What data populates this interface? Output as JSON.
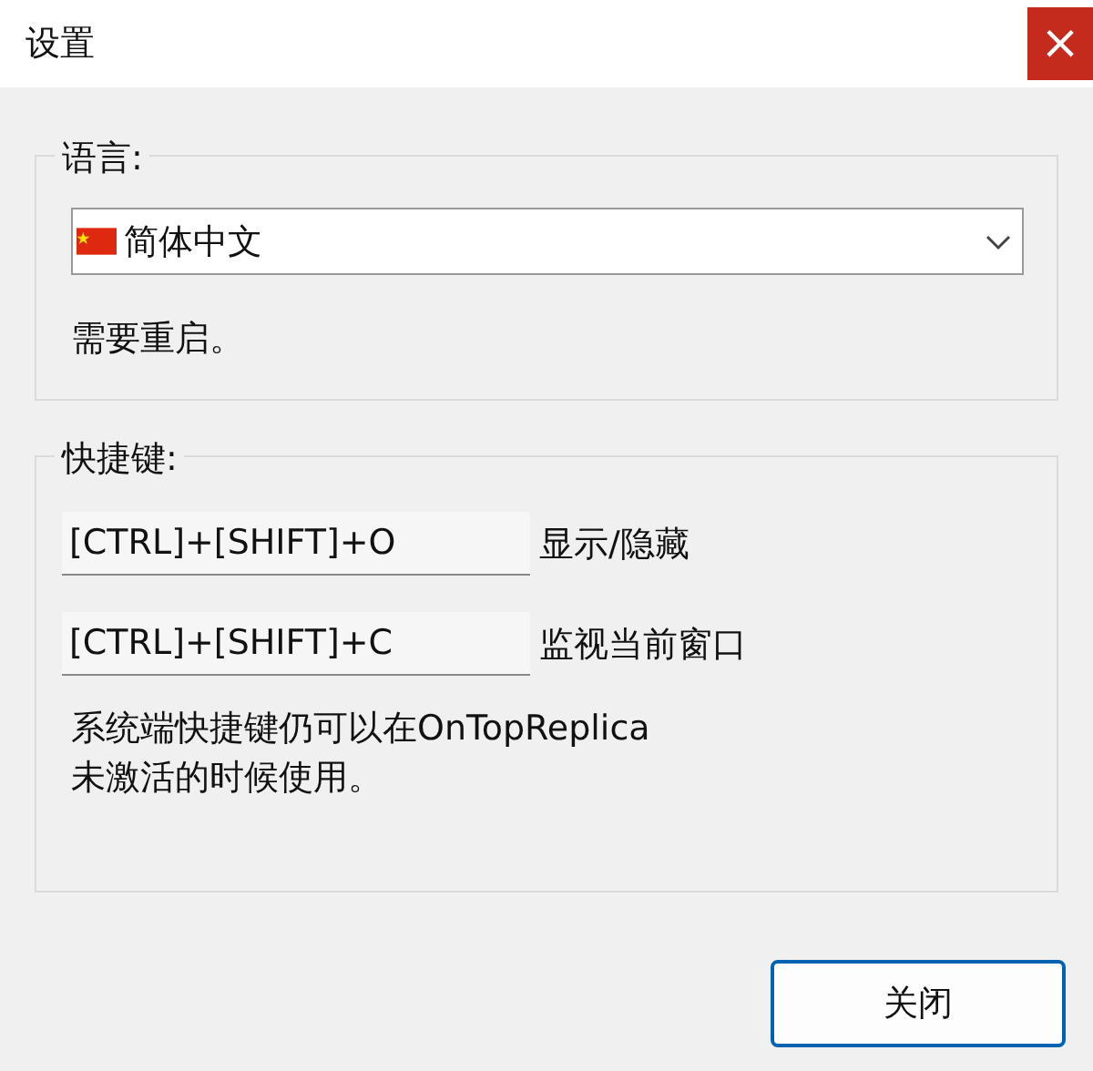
{
  "window": {
    "title": "设置",
    "close_label": "×"
  },
  "language": {
    "label": "语言:",
    "dropdown": {
      "value": "简体中文"
    },
    "note": "需要重启。"
  },
  "hotkeys": {
    "label": "快捷键:",
    "items": [
      {
        "keys": "[CTRL]+[SHIFT]+O",
        "action": "显示/隐藏"
      },
      {
        "keys": "[CTRL]+[SHIFT]+C",
        "action": "监视当前窗口"
      }
    ],
    "note": "系统端快捷键仍可以在OnTopReplica未激活的时候使用。"
  },
  "buttons": [
    "关闭"
  ]
}
